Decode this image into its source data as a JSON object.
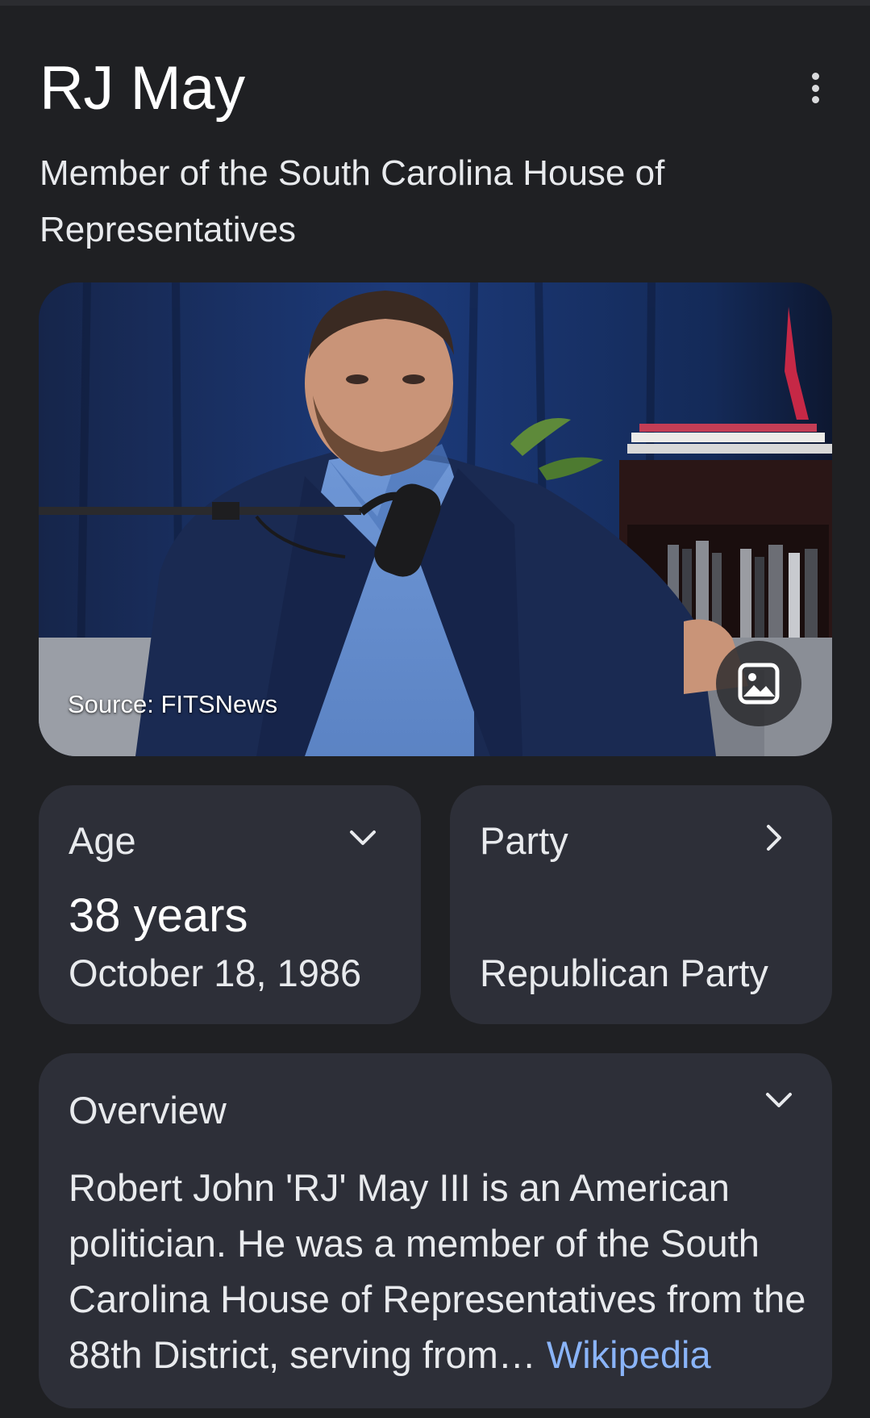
{
  "header": {
    "title": "RJ May",
    "subtitle": "Member of the South Carolina House of Representatives"
  },
  "hero_image": {
    "source_label": "Source: FITSNews",
    "icon": "image-icon"
  },
  "cards": {
    "age": {
      "label": "Age",
      "value": "38 years",
      "detail": "October 18, 1986",
      "icon": "chevron-down-icon"
    },
    "party": {
      "label": "Party",
      "value": "Republican Party",
      "icon": "chevron-right-icon"
    }
  },
  "overview": {
    "label": "Overview",
    "text": "Robert John 'RJ' May III is an American politician. He was a member of the South Carolina House of Representatives from the 88th District, serving from…",
    "link_text": "Wikipedia",
    "icon": "chevron-down-icon"
  },
  "colors": {
    "background": "#1f2023",
    "card": "#2d2f38",
    "link": "#8ab4f8"
  }
}
